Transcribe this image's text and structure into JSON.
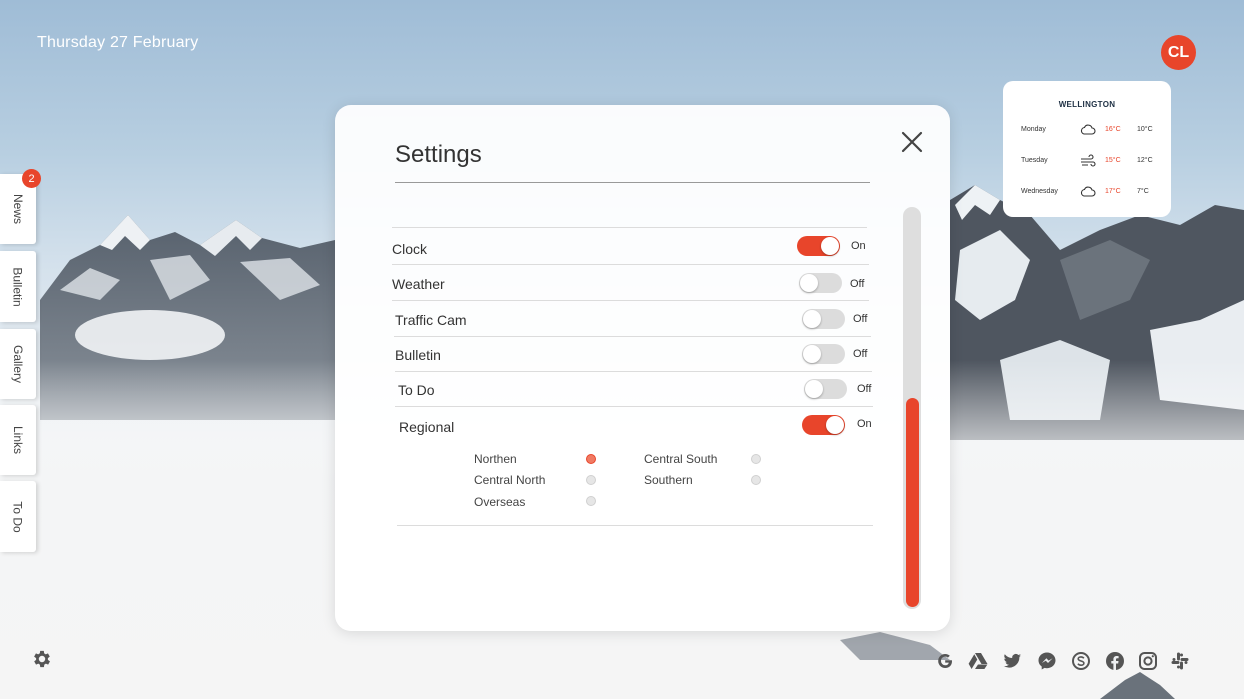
{
  "header": {
    "date": "Thursday 27 February",
    "avatar_initials": "CL"
  },
  "side_tabs": [
    {
      "label": "News",
      "badge": "2"
    },
    {
      "label": "Bulletin"
    },
    {
      "label": "Gallery"
    },
    {
      "label": "Links"
    },
    {
      "label": "To Do"
    }
  ],
  "weather": {
    "city": "WELLINGTON",
    "days": [
      {
        "day": "Monday",
        "icon": "cloud-icon",
        "high": "16°C",
        "low": "10°C"
      },
      {
        "day": "Tuesday",
        "icon": "wind-icon",
        "high": "15°C",
        "low": "12°C"
      },
      {
        "day": "Wednesday",
        "icon": "cloud-icon",
        "high": "17°C",
        "low": "7°C"
      }
    ]
  },
  "settings": {
    "title": "Settings",
    "items": [
      {
        "label": "Clock",
        "state": "On",
        "on": true
      },
      {
        "label": "Weather",
        "state": "Off",
        "on": false
      },
      {
        "label": "Traffic Cam",
        "state": "Off",
        "on": false
      },
      {
        "label": "Bulletin",
        "state": "Off",
        "on": false
      },
      {
        "label": "To Do",
        "state": "Off",
        "on": false
      },
      {
        "label": "Regional",
        "state": "On",
        "on": true
      }
    ],
    "regions": [
      {
        "label": "Northen",
        "selected": true
      },
      {
        "label": "Central North",
        "selected": false
      },
      {
        "label": "Overseas",
        "selected": false
      },
      {
        "label": "Central South",
        "selected": false
      },
      {
        "label": "Southern",
        "selected": false
      }
    ],
    "scroll_position": 0.5
  },
  "footer": {
    "social_icons": [
      "google-icon",
      "google-drive-icon",
      "twitter-icon",
      "messenger-icon",
      "skype-icon",
      "facebook-icon",
      "instagram-icon",
      "slack-icon"
    ]
  },
  "colors": {
    "accent": "#e8452b",
    "text": "#333333"
  }
}
